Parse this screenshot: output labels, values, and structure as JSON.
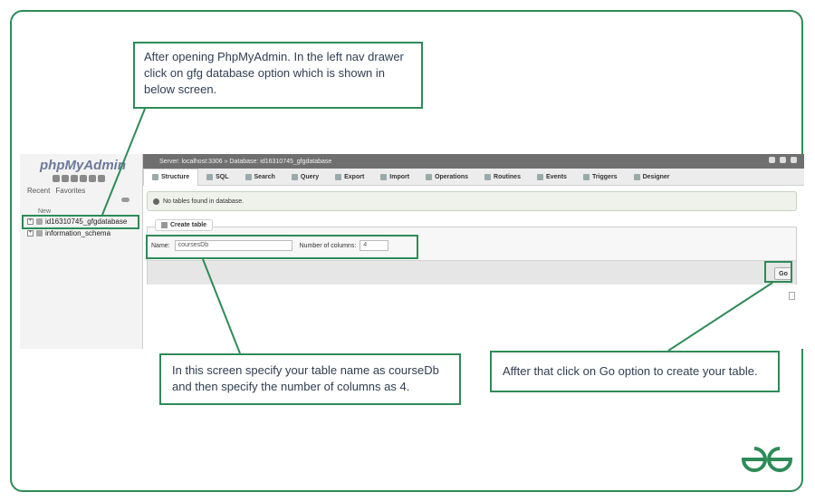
{
  "callouts": {
    "step1": "After opening PhpMyAdmin. In the left nav drawer click on gfg database option which is shown in below screen.",
    "step2": "In this screen specify your table name as courseDb and then specify the number of columns as 4.",
    "step3": "Affter that click on Go option to create your table."
  },
  "pma": {
    "logo": "phpMyAdmin",
    "nav_tabs": [
      "Recent",
      "Favorites"
    ],
    "tree_new": "New",
    "tree": {
      "selected_db": "id16310745_gfgdatabase",
      "other_db": "information_schema"
    },
    "breadcrumb": "Server: localhost:3306 » Database: id16310745_gfgdatabase",
    "menu_tabs": [
      "Structure",
      "SQL",
      "Search",
      "Query",
      "Export",
      "Import",
      "Operations",
      "Routines",
      "Events",
      "Triggers",
      "Designer"
    ],
    "notice": "No tables found in database.",
    "create_table": {
      "legend": "Create table",
      "name_label": "Name:",
      "name_value": "coursesDb",
      "columns_label": "Number of columns:",
      "columns_value": "4",
      "go_label": "Go"
    }
  },
  "colors": {
    "accent": "#2e8b57",
    "callout_text": "#2f3e52"
  },
  "logo": "GG"
}
